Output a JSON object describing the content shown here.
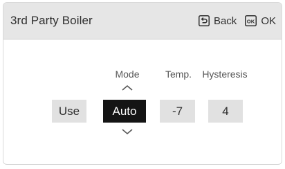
{
  "header": {
    "title": "3rd Party Boiler",
    "back_label": "Back",
    "ok_icon_text": "OK",
    "ok_label": "OK"
  },
  "columns": {
    "mode_label": "Mode",
    "temp_label": "Temp.",
    "hysteresis_label": "Hysteresis"
  },
  "values": {
    "use": "Use",
    "mode": "Auto",
    "temp": "-7",
    "hysteresis": "4"
  },
  "colors": {
    "header_bg": "#e6e6e6",
    "selected_bg": "#141414",
    "selected_text": "#ffffff",
    "cell_bg": "#e1e1e1"
  },
  "icons": [
    "back-icon",
    "ok-key-icon",
    "chevron-up-icon",
    "chevron-down-icon"
  ]
}
